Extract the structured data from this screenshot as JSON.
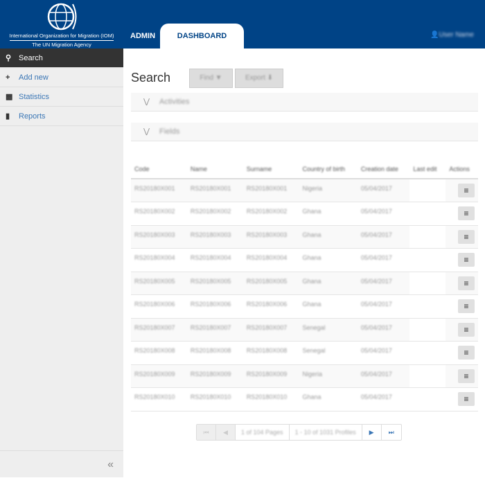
{
  "header": {
    "org_name": "International Organization for Migration (IOM)",
    "org_tagline": "The UN Migration Agency",
    "tabs": [
      {
        "label": "ADMIN"
      },
      {
        "label": "DASHBOARD"
      }
    ],
    "user_name": "User Name",
    "brand_color": "#004386"
  },
  "sidebar": {
    "items": [
      {
        "label": "Search",
        "icon": "search-icon"
      },
      {
        "label": "Add new",
        "icon": "plus-icon"
      },
      {
        "label": "Statistics",
        "icon": "bar-chart-icon"
      },
      {
        "label": "Reports",
        "icon": "file-icon"
      }
    ],
    "collapse": "«"
  },
  "main": {
    "title": "Search",
    "find_label": "Find",
    "export_label": "Export",
    "panels": [
      {
        "label": "Activities"
      },
      {
        "label": "Fields"
      }
    ],
    "table": {
      "headers": [
        "Code",
        "Name",
        "Surname",
        "Country of birth",
        "Creation date",
        "Last edit",
        "Actions"
      ],
      "rows": [
        [
          "RS20180X001",
          "RS20180X001",
          "RS20180X001",
          "Nigeria",
          "05/04/2017",
          ""
        ],
        [
          "RS20180X002",
          "RS20180X002",
          "RS20180X002",
          "Ghana",
          "05/04/2017",
          ""
        ],
        [
          "RS20180X003",
          "RS20180X003",
          "RS20180X003",
          "Ghana",
          "05/04/2017",
          ""
        ],
        [
          "RS20180X004",
          "RS20180X004",
          "RS20180X004",
          "Ghana",
          "05/04/2017",
          ""
        ],
        [
          "RS20180X005",
          "RS20180X005",
          "RS20180X005",
          "Ghana",
          "05/04/2017",
          ""
        ],
        [
          "RS20180X006",
          "RS20180X006",
          "RS20180X006",
          "Ghana",
          "05/04/2017",
          ""
        ],
        [
          "RS20180X007",
          "RS20180X007",
          "RS20180X007",
          "Senegal",
          "05/04/2017",
          ""
        ],
        [
          "RS20180X008",
          "RS20180X008",
          "RS20180X008",
          "Senegal",
          "05/04/2017",
          ""
        ],
        [
          "RS20180X009",
          "RS20180X009",
          "RS20180X009",
          "Nigeria",
          "05/04/2017",
          ""
        ],
        [
          "RS20180X010",
          "RS20180X010",
          "RS20180X010",
          "Ghana",
          "05/04/2017",
          ""
        ]
      ]
    },
    "pager": {
      "pages": "1 of 104 Pages",
      "range": "1 - 10 of 1031 Profiles"
    }
  }
}
